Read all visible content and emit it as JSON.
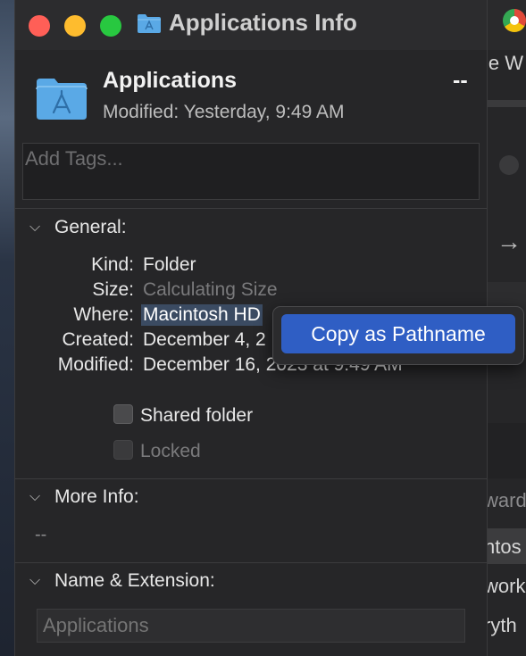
{
  "window": {
    "title": "Applications Info"
  },
  "header": {
    "name": "Applications",
    "size": "--",
    "modified": "Modified:  Yesterday, 9:49 AM"
  },
  "tags": {
    "placeholder": "Add Tags..."
  },
  "general": {
    "heading": "General:",
    "rows": [
      {
        "label": "Kind:",
        "value": "Folder"
      },
      {
        "label": "Size:",
        "value": "Calculating Size"
      },
      {
        "label": "Where:",
        "value": "Macintosh HD"
      },
      {
        "label": "Created:",
        "value": "December 4, 2"
      },
      {
        "label": "Modified:",
        "value": "December 16, 2023 at 9:49 AM"
      }
    ],
    "shared_folder": "Shared folder",
    "locked": "Locked"
  },
  "more_info": {
    "heading": "More Info:",
    "value": "--"
  },
  "name_extension": {
    "heading": "Name & Extension:",
    "placeholder": "Applications"
  },
  "context_menu": {
    "item": "Copy as Pathname"
  },
  "background": {
    "texts": [
      "le W",
      "ward",
      "ntos",
      "work",
      "ryth"
    ]
  },
  "colors": {
    "window_bg": "#262628",
    "accent": "#2f5ec4",
    "folder_blue": "#5aa9e6",
    "close": "#ff5f57",
    "minimize": "#febc2e",
    "zoom": "#28c840"
  },
  "icons": [
    "folder-icon",
    "chevron-down-icon",
    "checkbox-icon",
    "arrow-right-icon",
    "chrome-icon"
  ]
}
